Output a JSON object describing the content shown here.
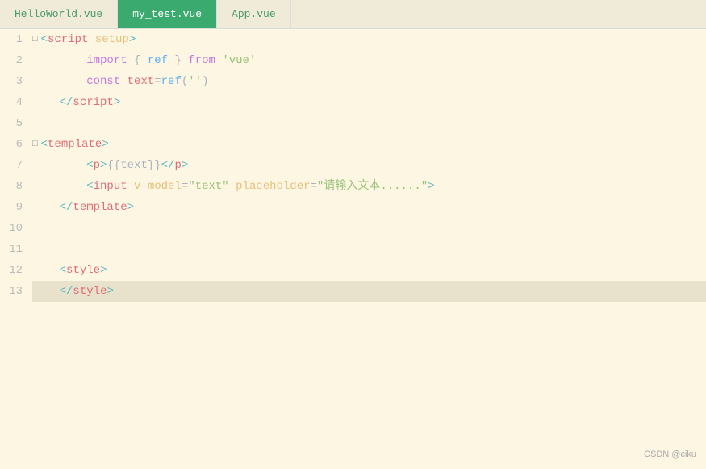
{
  "tabs": [
    {
      "id": "helloworld",
      "label": "HelloWorld.vue",
      "active": false
    },
    {
      "id": "mytest",
      "label": "my_test.vue",
      "active": true
    },
    {
      "id": "app",
      "label": "App.vue",
      "active": false
    }
  ],
  "lines": [
    {
      "num": "1",
      "content": "script_setup",
      "highlighted": false
    },
    {
      "num": "2",
      "content": "import_ref",
      "highlighted": false
    },
    {
      "num": "3",
      "content": "const_text",
      "highlighted": false
    },
    {
      "num": "4",
      "content": "script_close",
      "highlighted": false
    },
    {
      "num": "5",
      "content": "empty",
      "highlighted": false
    },
    {
      "num": "6",
      "content": "template_open",
      "highlighted": false
    },
    {
      "num": "7",
      "content": "p_tag",
      "highlighted": false
    },
    {
      "num": "8",
      "content": "input_tag",
      "highlighted": false
    },
    {
      "num": "9",
      "content": "template_close",
      "highlighted": false
    },
    {
      "num": "10",
      "content": "empty",
      "highlighted": false
    },
    {
      "num": "11",
      "content": "empty",
      "highlighted": false
    },
    {
      "num": "12",
      "content": "style_open",
      "highlighted": false
    },
    {
      "num": "13",
      "content": "style_close",
      "highlighted": true
    }
  ],
  "watermark": "CSDN @ciku",
  "colors": {
    "bg": "#fdf6e3",
    "tab_active_bg": "#3aaa6e",
    "tab_active_text": "#ffffff",
    "tab_inactive_text": "#4a9a6e",
    "line_highlight": "#e8e2cc"
  }
}
